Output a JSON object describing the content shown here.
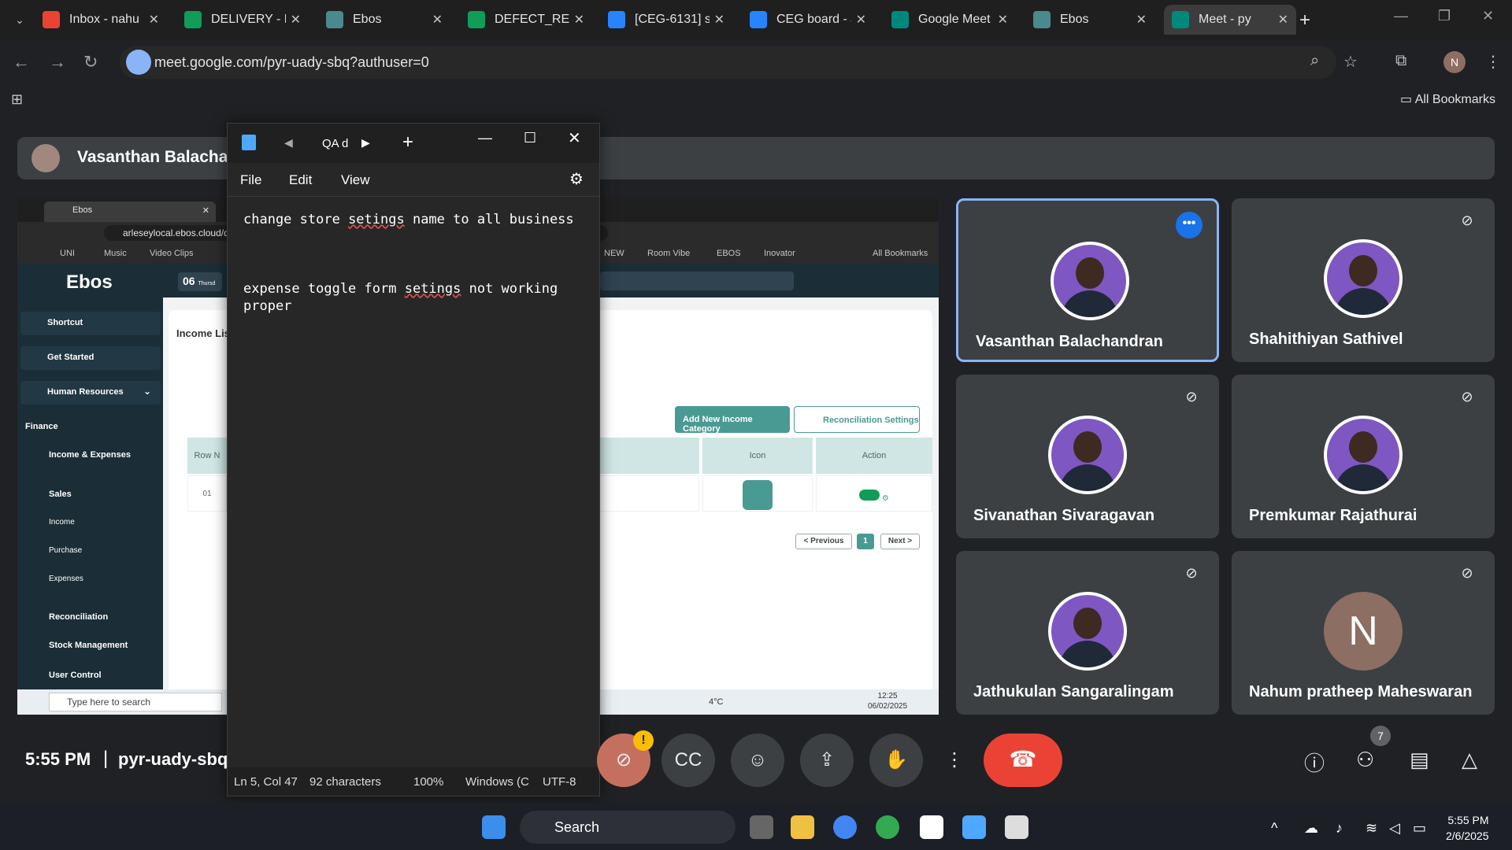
{
  "browser": {
    "tabs": [
      {
        "label": "Inbox - nahu",
        "color": "#ea4335"
      },
      {
        "label": "DELIVERY - P",
        "color": "#0f9d58"
      },
      {
        "label": "Ebos",
        "color": "#4a8a8c"
      },
      {
        "label": "DEFECT_REPO",
        "color": "#0f9d58"
      },
      {
        "label": "[CEG-6131] s",
        "color": "#2684ff"
      },
      {
        "label": "CEG board - J",
        "color": "#2684ff"
      },
      {
        "label": "Google Meet",
        "color": "#00897b"
      },
      {
        "label": "Ebos",
        "color": "#4a8a8c"
      },
      {
        "label": "Meet - py",
        "color": "#00897b"
      }
    ],
    "url": "meet.google.com/pyr-uady-sbq?authuser=0",
    "profile_initial": "N",
    "bookmarks_all": "All Bookmarks"
  },
  "presenter": {
    "name": "Vasanthan Balachand"
  },
  "shared_screen": {
    "tab_label": "Ebos",
    "url": "arleseylocal.ebos.cloud/d",
    "bookmarks": [
      "UNI",
      "Music",
      "Video Clips",
      "NEW",
      "Room Vibe",
      "EBOS",
      "Inovator",
      "All Bookmarks"
    ],
    "logo": "Ebos",
    "date": "06",
    "date_sub": "Thursd",
    "sidebar": {
      "shortcut": "Shortcut",
      "get_started": "Get Started",
      "human_resources": "Human Resources",
      "finance": "Finance",
      "income_expenses": "Income & Expenses",
      "sales": "Sales",
      "income": "Income",
      "purchase": "Purchase",
      "expenses": "Expenses",
      "reconciliation": "Reconciliation",
      "stock_management": "Stock Management",
      "user_control": "User Control"
    },
    "page_title": "Income Lis",
    "add_button": "Add New Income Category",
    "settings_button": "Reconciliation Settings",
    "col_row": "Row N",
    "col_icon": "Icon",
    "col_action": "Action",
    "row_num": "01",
    "row_partial": "on",
    "pager": {
      "prev": "< Previous",
      "page": "1",
      "next": "Next >"
    },
    "taskbar_search": "Type here to search",
    "weather": "4°C",
    "time": "12:25",
    "date_full": "06/02/2025"
  },
  "notepad": {
    "tab_title": "QA d",
    "menu": {
      "file": "File",
      "edit": "Edit",
      "view": "View"
    },
    "lines": [
      {
        "a": "change store ",
        "b": "setings",
        "c": " name to all business"
      },
      {
        "a": "expense toggle form ",
        "b": "setings",
        "c": " not working"
      },
      {
        "a": "proper",
        "b": "",
        "c": ""
      }
    ],
    "status": {
      "pos": "Ln 5, Col 47",
      "chars": "92 characters",
      "zoom": "100%",
      "eol": "Windows (C",
      "enc": "UTF-8"
    }
  },
  "participants": [
    {
      "name": "Vasanthan Balachandran",
      "speaking": true
    },
    {
      "name": "Shahithiyan Sathivel",
      "speaking": false
    },
    {
      "name": "Sivanathan Sivaragavan",
      "speaking": false
    },
    {
      "name": "Premkumar Rajathurai",
      "speaking": false
    },
    {
      "name": "Jathukulan Sangaralingam",
      "speaking": false
    },
    {
      "name": "Nahum pratheep Maheswaran",
      "speaking": false,
      "initial": "N"
    }
  ],
  "controls": {
    "time": "5:55 PM",
    "meeting_code": "pyr-uady-sbq",
    "people_count": "7"
  },
  "taskbar": {
    "search": "Search",
    "time": "5:55 PM",
    "date": "2/6/2025"
  }
}
